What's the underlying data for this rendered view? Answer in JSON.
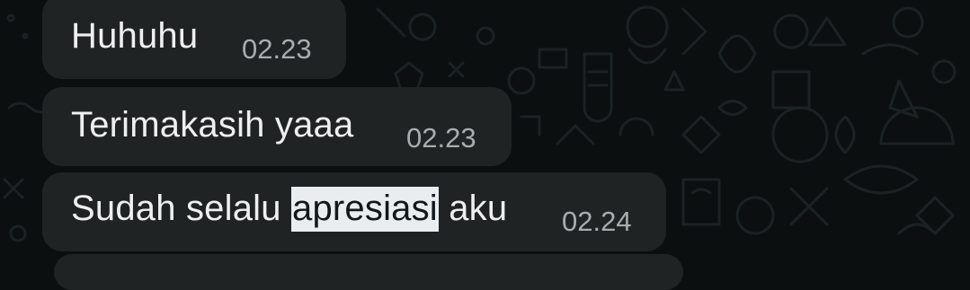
{
  "messages": [
    {
      "text": "Huhuhu",
      "time": "02.23"
    },
    {
      "text": "Terimakasih yaaa",
      "time": "02.23"
    },
    {
      "text_before": "Sudah selalu ",
      "text_selected": "apresiasi",
      "text_after": " aku",
      "time": "02.24"
    }
  ],
  "colors": {
    "background": "#0b0f10",
    "bubble": "#1f2324",
    "text": "#eef0f0",
    "time": "#a8adaf",
    "selection": "#e9edef"
  }
}
